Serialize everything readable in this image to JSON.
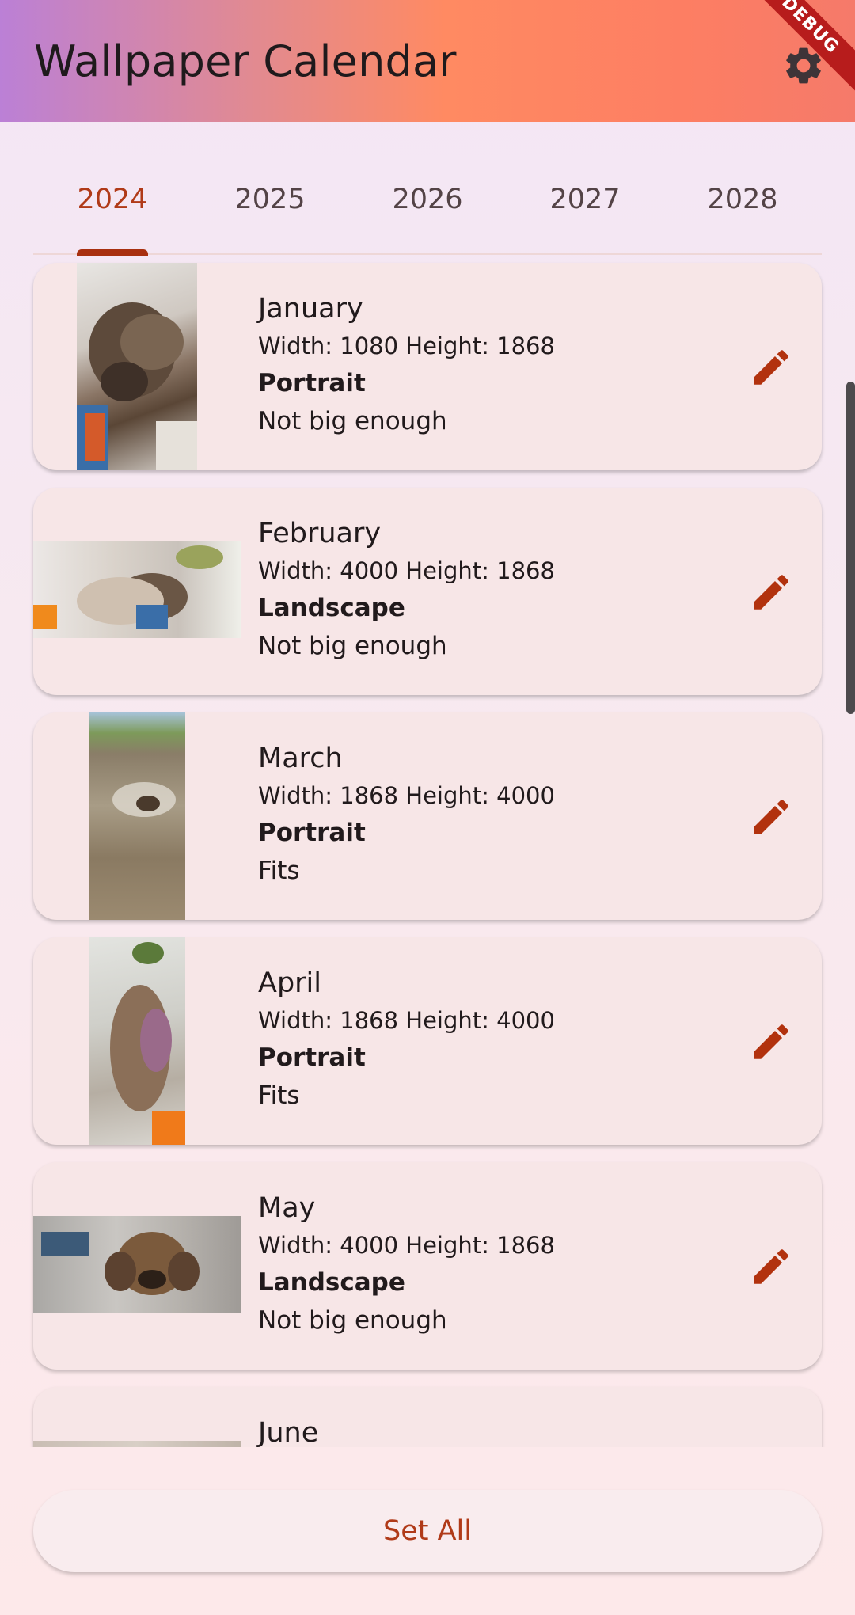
{
  "app": {
    "title": "Wallpaper Calendar",
    "debug_label": "DEBUG"
  },
  "colors": {
    "accent": "#b03a18",
    "card": "#f7e6e7",
    "edit_icon": "#b2320e"
  },
  "tabs": [
    {
      "label": "2024",
      "active": true
    },
    {
      "label": "2025",
      "active": false
    },
    {
      "label": "2026",
      "active": false
    },
    {
      "label": "2027",
      "active": false
    },
    {
      "label": "2028",
      "active": false
    }
  ],
  "months": [
    {
      "name": "January",
      "dims": "Width: 1080 Height: 1868",
      "orientation": "Portrait",
      "status": "Not big enough"
    },
    {
      "name": "February",
      "dims": "Width: 4000 Height: 1868",
      "orientation": "Landscape",
      "status": "Not big enough"
    },
    {
      "name": "March",
      "dims": "Width: 1868 Height: 4000",
      "orientation": "Portrait",
      "status": "Fits"
    },
    {
      "name": "April",
      "dims": "Width: 1868 Height: 4000",
      "orientation": "Portrait",
      "status": "Fits"
    },
    {
      "name": "May",
      "dims": "Width: 4000 Height: 1868",
      "orientation": "Landscape",
      "status": "Not big enough"
    },
    {
      "name": "June"
    }
  ],
  "actions": {
    "set_all": "Set All"
  }
}
